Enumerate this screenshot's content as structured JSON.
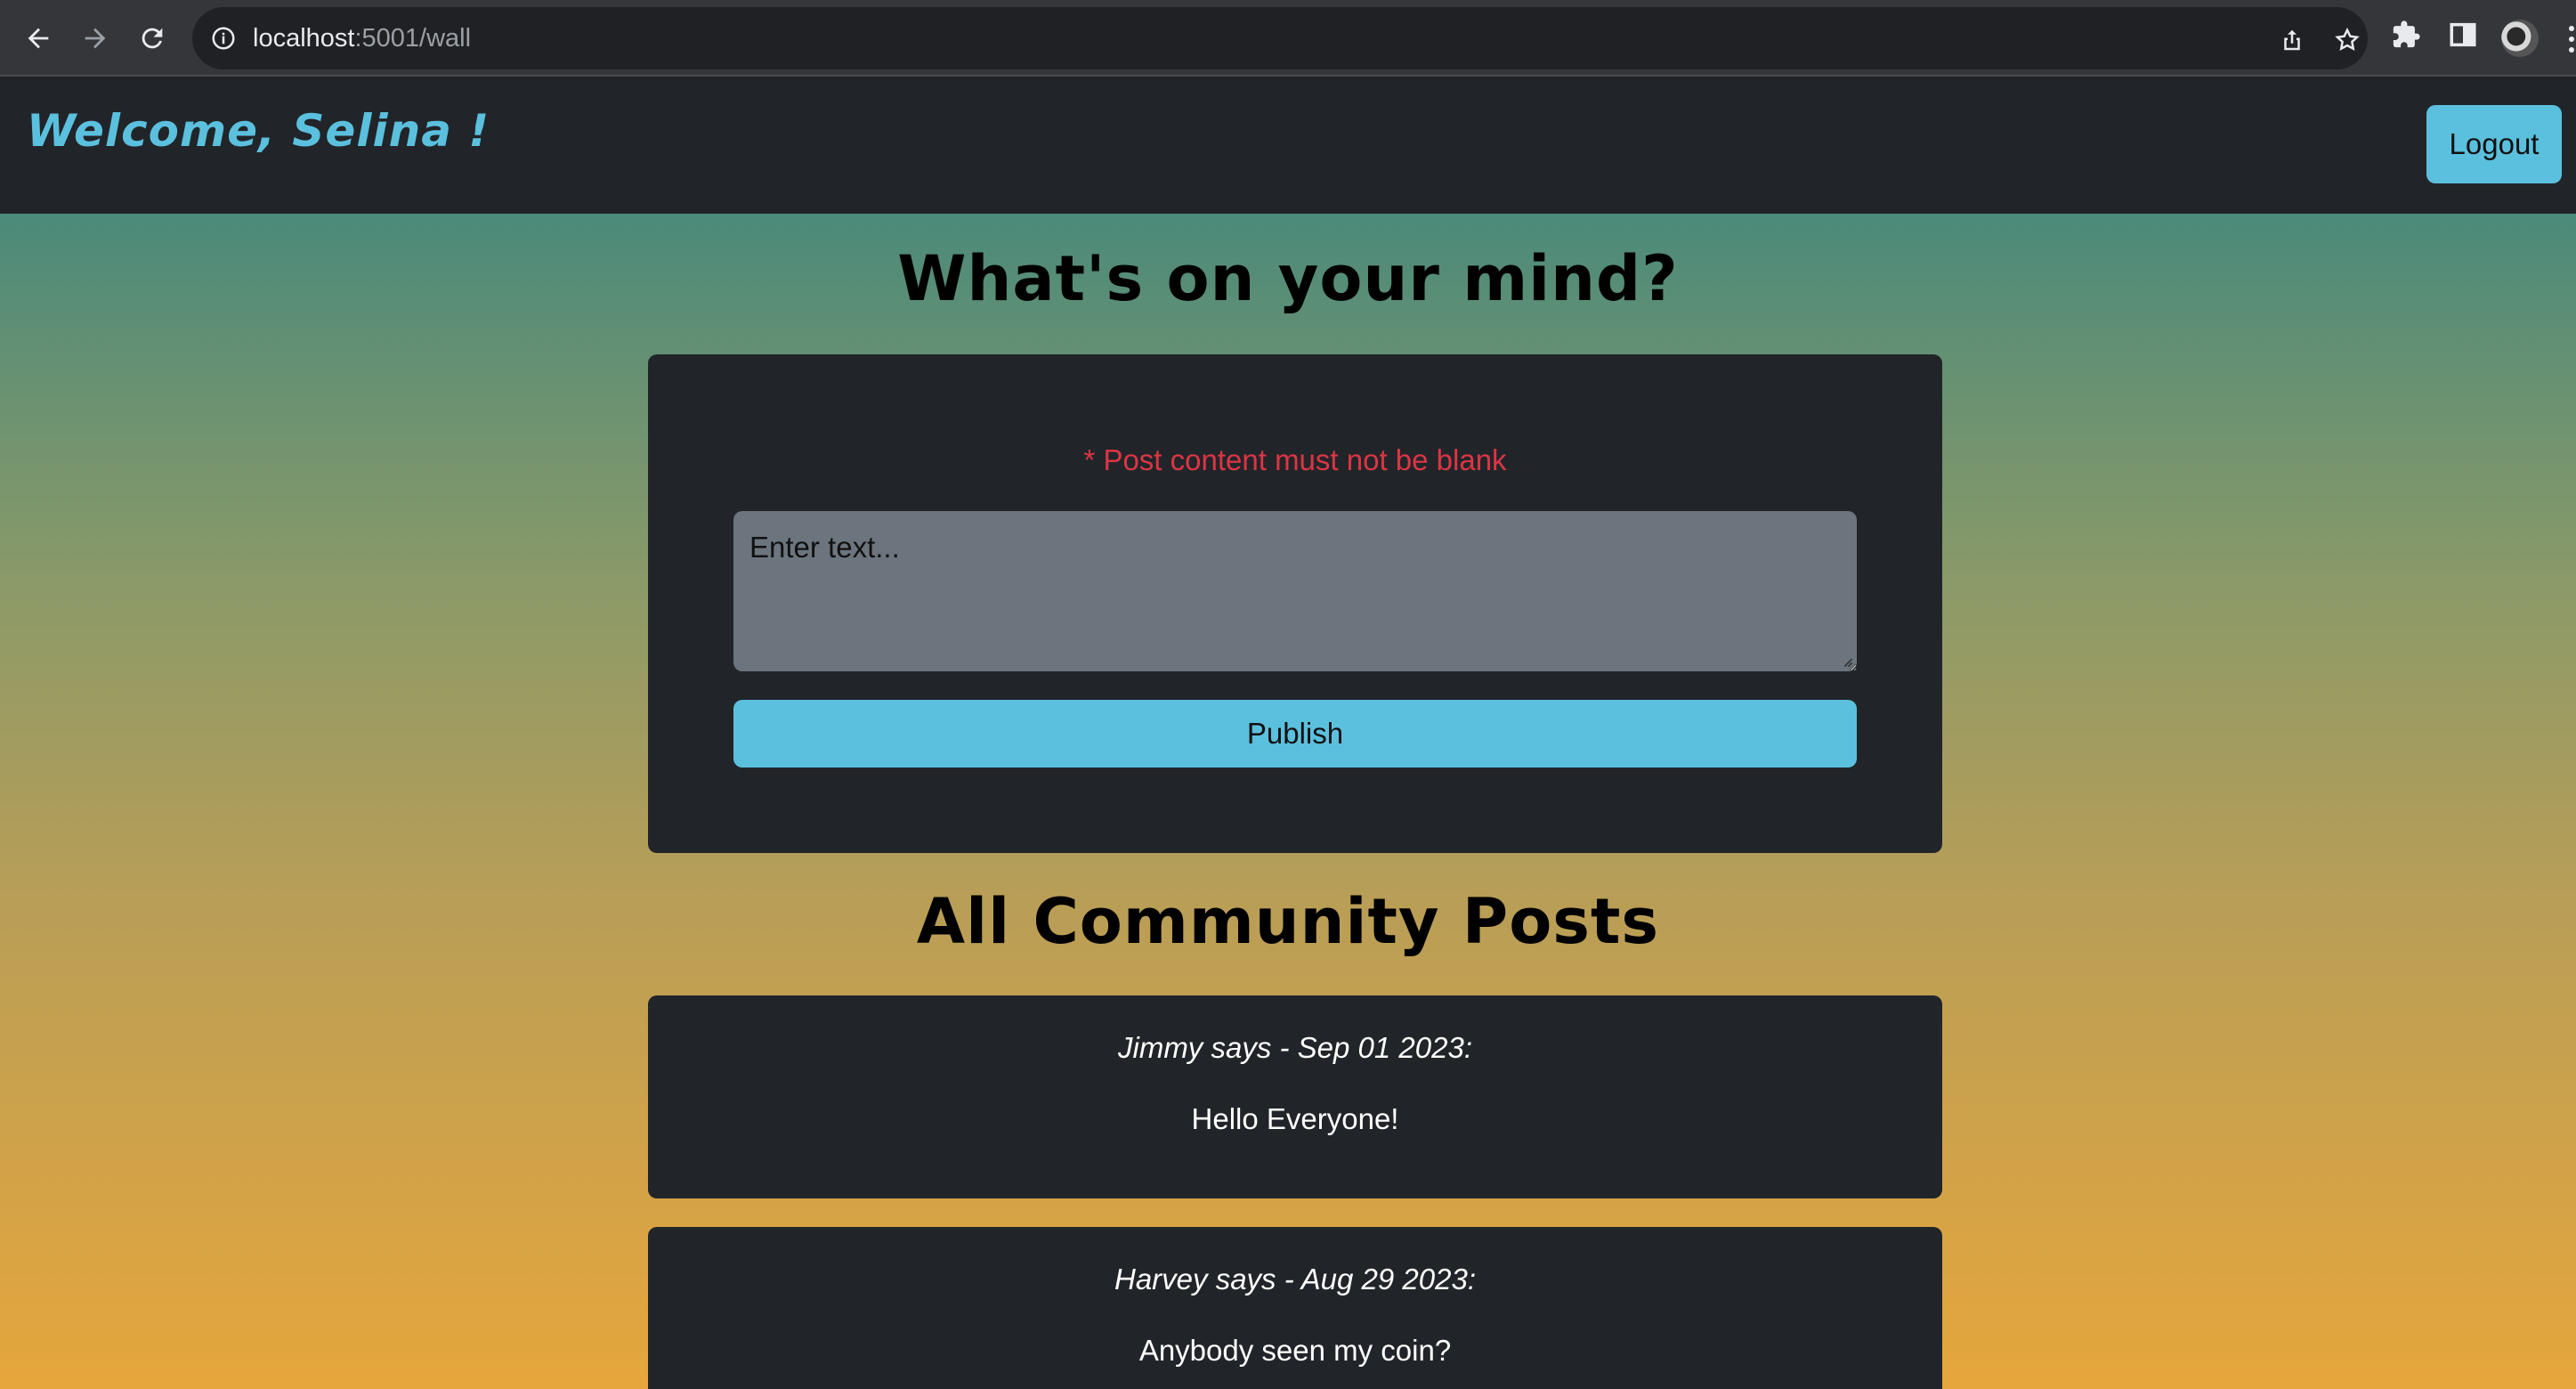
{
  "browser": {
    "url_host": "localhost",
    "url_path": ":5001/wall",
    "icons": [
      "back-arrow-icon",
      "forward-arrow-icon",
      "reload-icon",
      "info-icon",
      "share-icon",
      "bookmark-star-icon",
      "extensions-puzzle-icon",
      "side-panel-icon",
      "profile-avatar",
      "menu-dots-icon"
    ]
  },
  "navbar": {
    "welcome_text": "Welcome, Selina !",
    "logout_label": "Logout",
    "accent_color": "#5bc0de"
  },
  "compose": {
    "heading": "What's on your mind?",
    "error_message": "* Post content must not be blank",
    "placeholder": "Enter text...",
    "value": "",
    "publish_label": "Publish"
  },
  "posts_section": {
    "heading": "All Community Posts",
    "posts": [
      {
        "meta": "Jimmy says - Sep 01 2023:",
        "body": "Hello Everyone!"
      },
      {
        "meta": "Harvey says - Aug 29 2023:",
        "body": "Anybody seen my coin?"
      }
    ]
  },
  "colors": {
    "card_bg": "#212529",
    "error": "#dc3545",
    "gradient_top": "#4b8a7a",
    "gradient_bottom": "#e6a63c"
  }
}
